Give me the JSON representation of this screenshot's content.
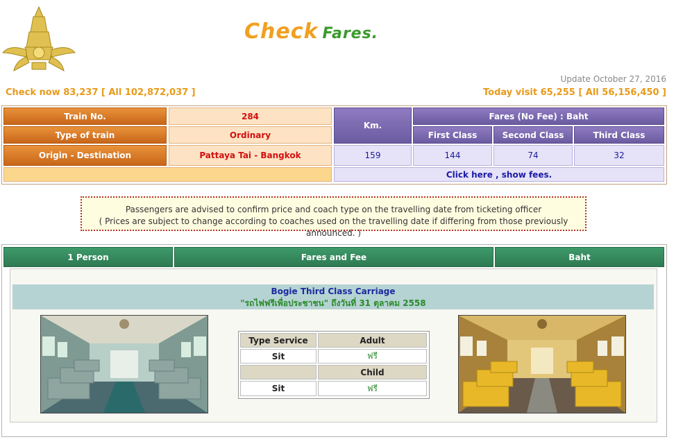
{
  "header": {
    "logo_icon": "state-railway-emblem",
    "title_part1": "Check",
    "title_part2": "Fares.",
    "update": "Update October 27, 2016",
    "check_now": "Check now 83,237 [ All 102,872,037 ]",
    "today_visit": "Today visit 65,255 [ All 56,156,450 ]"
  },
  "info": {
    "train_no_label": "Train No.",
    "train_no": "284",
    "type_label": "Type of train",
    "type": "Ordinary",
    "route_label": "Origin - Destination",
    "route": "Pattaya Tai - Bangkok",
    "km_label": "Km.",
    "km": "159",
    "fares_label": "Fares (No Fee) : Baht",
    "first_label": "First Class",
    "second_label": "Second Class",
    "third_label": "Third Class",
    "first": "144",
    "second": "74",
    "third": "32",
    "show_fees": "Click here , show fees."
  },
  "notice": {
    "line1": "Passengers are advised to confirm price and coach type on the travelling date from ticketing officer",
    "line2": "( Prices are subject to change according to coaches used on the travelling date if differing from those previously announced. )"
  },
  "fare_panel": {
    "col1": "1 Person",
    "col2": "Fares and Fee",
    "col3": "Baht",
    "carriage_title": "Bogie Third Class Carriage",
    "carriage_note": "\"รถไฟฟรีเพื่อประชาชน\" ถึงวันที่ 31 ตุลาคม 2558",
    "table": {
      "type_service": "Type Service",
      "adult": "Adult",
      "sit1": "Sit",
      "free1": "ฟรี",
      "child": "Child",
      "sit2": "Sit",
      "free2": "ฟรี"
    }
  },
  "colors": {
    "accent_orange": "#e89a1a",
    "header_green": "#2e7a52",
    "header_purple": "#6a5ba0"
  }
}
